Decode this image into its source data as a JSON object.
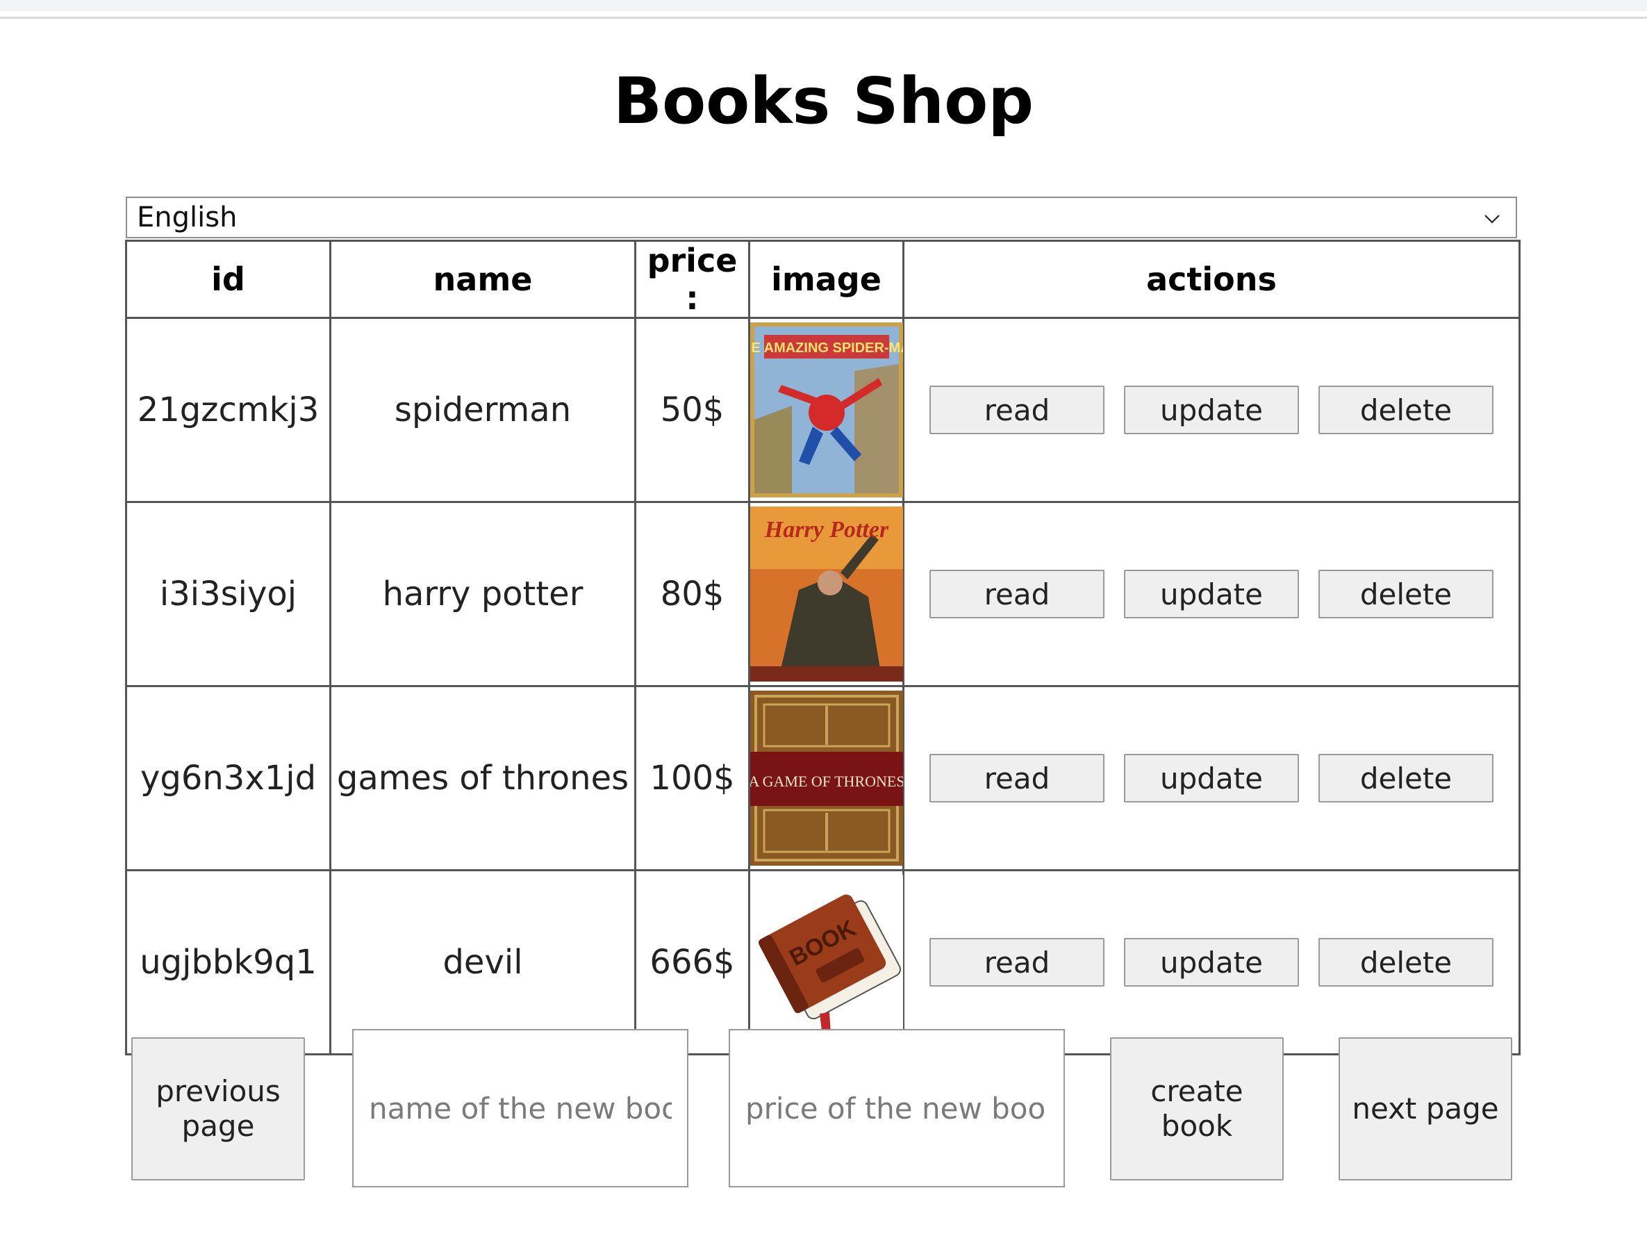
{
  "page": {
    "title": "Books Shop"
  },
  "language": {
    "selected": "English"
  },
  "table": {
    "headers": {
      "id": "id",
      "name": "name",
      "price": "price :",
      "image": "image",
      "actions": "actions"
    },
    "rows": [
      {
        "id": "21gzcmkj3",
        "name": "spiderman",
        "price": "50$",
        "image": "spiderman-cover",
        "cover_text": "THE AMAZING SPIDER-MAN"
      },
      {
        "id": "i3i3siyoj",
        "name": "harry potter",
        "price": "80$",
        "image": "harry-potter-cover",
        "cover_text": "Harry Potter"
      },
      {
        "id": "yg6n3x1jd",
        "name": "games of thrones",
        "price": "100$",
        "image": "game-of-thrones-cover",
        "cover_text": "A GAME OF THRONES"
      },
      {
        "id": "ugjbbk9q1",
        "name": "devil",
        "price": "666$",
        "image": "book-icon",
        "cover_text": "BOOK"
      }
    ],
    "row_actions": {
      "read": "read",
      "update": "update",
      "delete": "delete"
    }
  },
  "footer": {
    "previous_page": "previous\npage",
    "name_placeholder": "name of the new book",
    "price_placeholder": "price of the new book",
    "create_book": "create\nbook",
    "next_page": "next page"
  }
}
